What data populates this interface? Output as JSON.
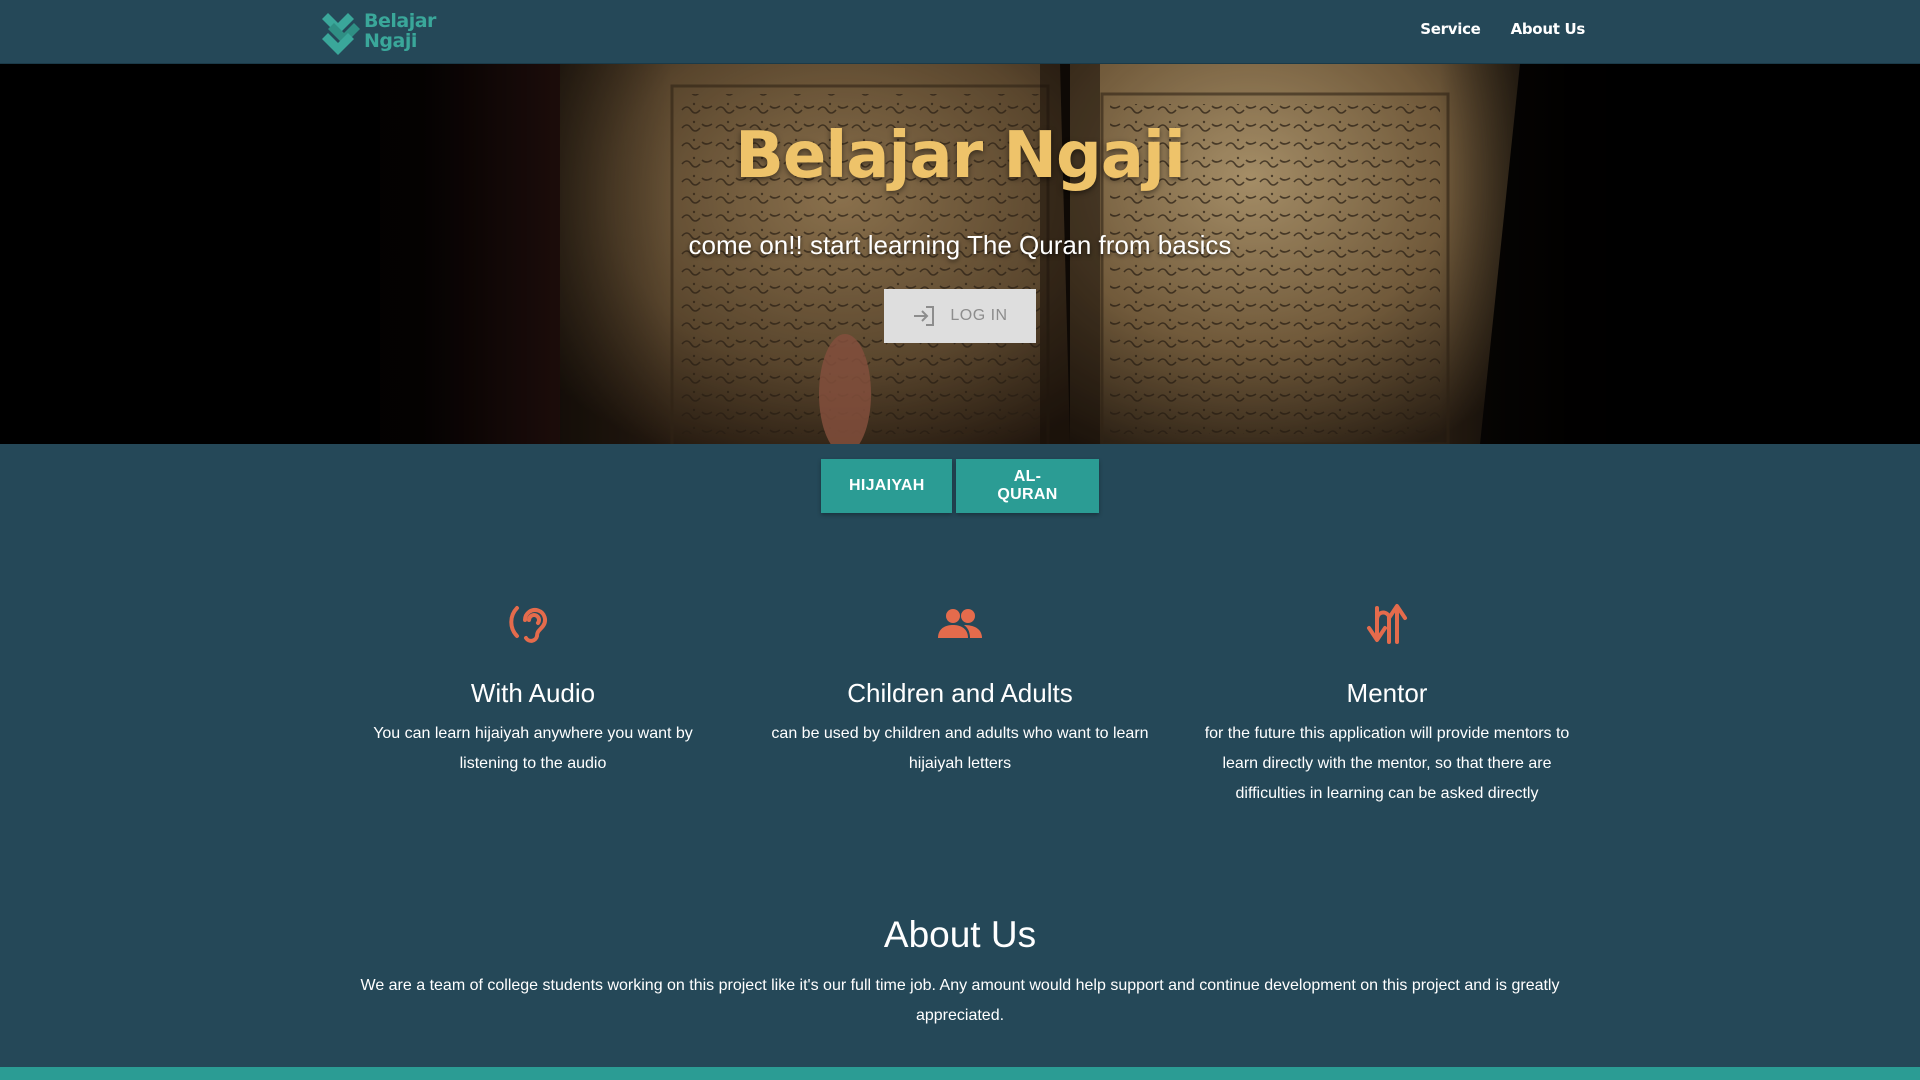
{
  "navbar": {
    "logo_line1": "Belajar",
    "logo_line2": "Ngaji",
    "links": [
      {
        "label": "Service"
      },
      {
        "label": "About Us"
      }
    ]
  },
  "hero": {
    "title": "Belajar Ngaji",
    "subtitle": "come on!! start learning The Quran from basics",
    "login_label": "LOG IN"
  },
  "tabs": [
    {
      "label": "HIJAIYAH"
    },
    {
      "label": "AL-QURAN"
    }
  ],
  "features": [
    {
      "icon": "ear-icon",
      "title": "With Audio",
      "description": "You can learn hijaiyah anywhere you want by listening to the audio"
    },
    {
      "icon": "people-icon",
      "title": "Children and Adults",
      "description": "can be used by children and adults who want to learn hijaiyah letters"
    },
    {
      "icon": "swap-arrows-icon",
      "title": "Mentor",
      "description": "for the future this application will provide mentors to learn directly with the mentor, so that there are difficulties in learning can be asked directly"
    }
  ],
  "about": {
    "title": "About Us",
    "text": "We are a team of college students working on this project like it's our full time job. Any amount would help support and continue development on this project and is greatly appreciated."
  },
  "colors": {
    "background": "#254858",
    "accent_teal": "#2b9c94",
    "hero_title": "#eec36a",
    "icon_orange": "#e46b4c"
  }
}
